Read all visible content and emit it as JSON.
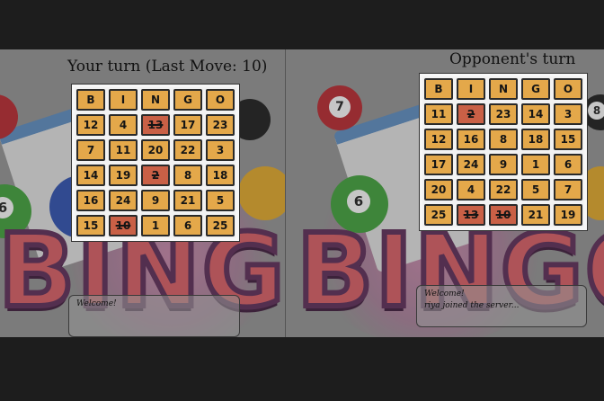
{
  "left": {
    "title": "Your turn (Last Move: 10)",
    "header": [
      "B",
      "I",
      "N",
      "G",
      "O"
    ],
    "rows": [
      [
        {
          "v": "12"
        },
        {
          "v": "4"
        },
        {
          "v": "13",
          "m": true
        },
        {
          "v": "17"
        },
        {
          "v": "23"
        }
      ],
      [
        {
          "v": "7"
        },
        {
          "v": "11"
        },
        {
          "v": "20"
        },
        {
          "v": "22"
        },
        {
          "v": "3"
        }
      ],
      [
        {
          "v": "14"
        },
        {
          "v": "19"
        },
        {
          "v": "2",
          "m": true
        },
        {
          "v": "8"
        },
        {
          "v": "18"
        }
      ],
      [
        {
          "v": "16"
        },
        {
          "v": "24"
        },
        {
          "v": "9"
        },
        {
          "v": "21"
        },
        {
          "v": "5"
        }
      ],
      [
        {
          "v": "15"
        },
        {
          "v": "10",
          "m": true
        },
        {
          "v": "1"
        },
        {
          "v": "6"
        },
        {
          "v": "25"
        }
      ]
    ],
    "chat": [
      "Welcome!"
    ]
  },
  "right": {
    "title": "Opponent's turn",
    "header": [
      "B",
      "I",
      "N",
      "G",
      "O"
    ],
    "rows": [
      [
        {
          "v": "11"
        },
        {
          "v": "2",
          "m": true
        },
        {
          "v": "23"
        },
        {
          "v": "14"
        },
        {
          "v": "3"
        }
      ],
      [
        {
          "v": "12"
        },
        {
          "v": "16"
        },
        {
          "v": "8"
        },
        {
          "v": "18"
        },
        {
          "v": "15"
        }
      ],
      [
        {
          "v": "17"
        },
        {
          "v": "24"
        },
        {
          "v": "9"
        },
        {
          "v": "1"
        },
        {
          "v": "6"
        }
      ],
      [
        {
          "v": "20"
        },
        {
          "v": "4"
        },
        {
          "v": "22"
        },
        {
          "v": "5"
        },
        {
          "v": "7"
        }
      ],
      [
        {
          "v": "25"
        },
        {
          "v": "13",
          "m": true
        },
        {
          "v": "10",
          "m": true
        },
        {
          "v": "21"
        },
        {
          "v": "19"
        }
      ]
    ],
    "chat": [
      "Welcome!",
      "riya joined the server..."
    ]
  },
  "background": {
    "logo_text": "BINGO",
    "ball_numbers": [
      "7",
      "6",
      "8"
    ]
  },
  "colors": {
    "cell": "#e4a84a",
    "marked": "#c96046",
    "page": "#1d1d1d"
  }
}
